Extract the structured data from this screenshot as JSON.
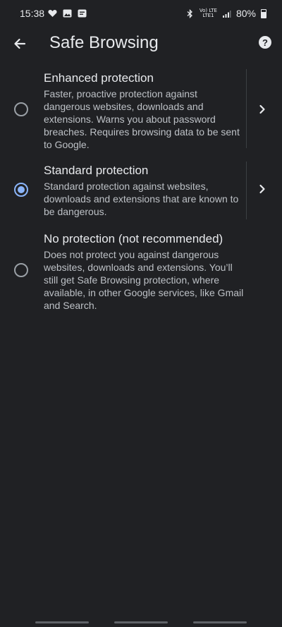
{
  "status_bar": {
    "time": "15:38",
    "battery": "80%",
    "network_top": "Vo) LTE",
    "network_bottom": "LTE1",
    "left_icons": [
      "heart-icon",
      "image-icon",
      "chat-icon"
    ],
    "right_icons": [
      "bluetooth-icon",
      "signal-icon",
      "battery-icon"
    ]
  },
  "app_bar": {
    "title": "Safe Browsing",
    "back_icon": "arrow-back-icon",
    "help_icon": "help-icon"
  },
  "options": [
    {
      "title": "Enhanced protection",
      "description": "Faster, proactive protection against dangerous websites, downloads and extensions. Warns you about password breaches. Requires browsing data to be sent to Google.",
      "selected": false,
      "has_details": true
    },
    {
      "title": "Standard protection",
      "description": "Standard protection against websites, downloads and extensions that are known to be dangerous.",
      "selected": true,
      "has_details": true
    },
    {
      "title": "No protection (not recommended)",
      "description": "Does not protect you against dangerous websites, downloads and extensions. You’ll still get Safe Browsing protection, where available, in other Google services, like Gmail and Search.",
      "selected": false,
      "has_details": false
    }
  ],
  "colors": {
    "background": "#202124",
    "text_primary": "#e8eaed",
    "text_secondary": "#bdc1c6",
    "accent": "#8ab4f8",
    "radio_unchecked": "#9aa0a6"
  }
}
